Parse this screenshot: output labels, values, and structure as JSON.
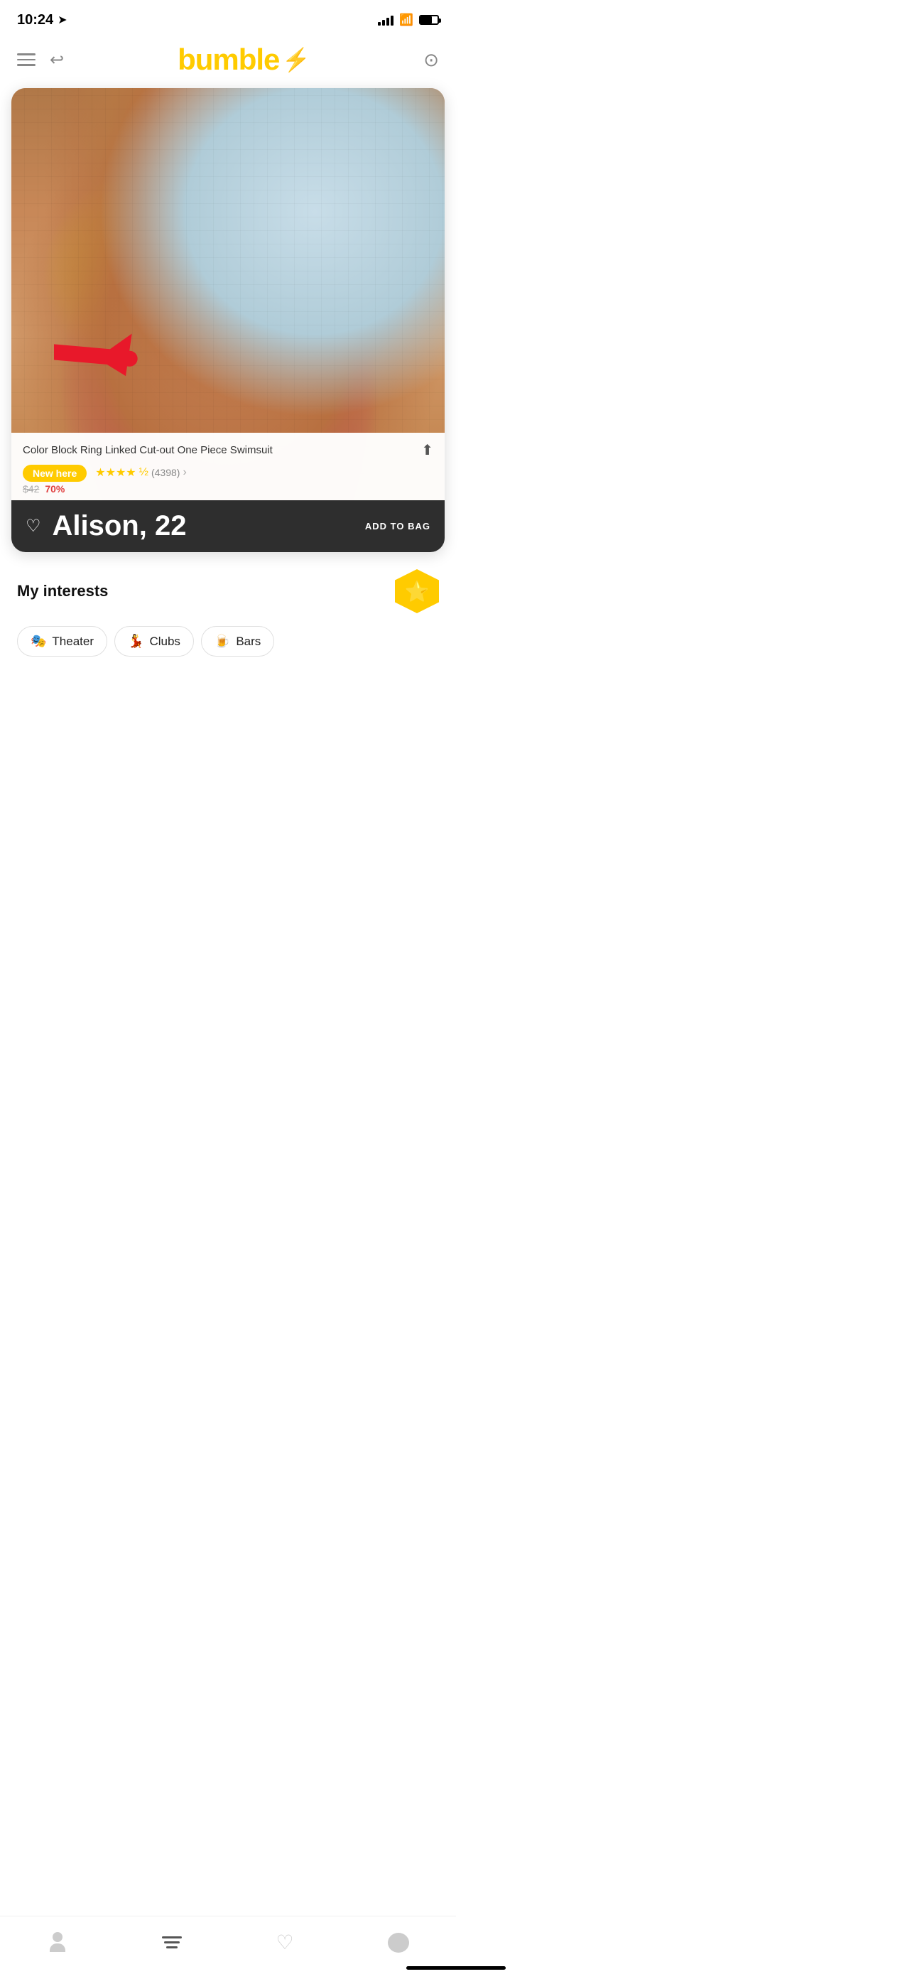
{
  "statusBar": {
    "time": "10:24",
    "locationIcon": "➤"
  },
  "header": {
    "menuIcon": "menu",
    "backIcon": "↩",
    "logo": "bumble",
    "logoLightning": "⚡",
    "filterIcon": "⊙"
  },
  "profileCard": {
    "productName": "Color Block Ring Linked Cut-out One Piece Swimsuit",
    "newHereBadge": "New here",
    "stars": "★★★★½",
    "reviewCount": "(4398)",
    "shareIcon": "↑",
    "priceOriginal": "$42",
    "priceDiscounted": "70%",
    "addToBagLabel": "ADD TO BAG",
    "personName": "Alison, 22",
    "heartIcon": "♡"
  },
  "interests": {
    "title": "My interests",
    "tags": [
      {
        "emoji": "🎭",
        "label": "Theater"
      },
      {
        "emoji": "💃",
        "label": "Clubs"
      },
      {
        "emoji": "🍺",
        "label": "Bars"
      }
    ],
    "boostIcon": "⭐"
  },
  "bottomNav": {
    "items": [
      {
        "id": "profile",
        "icon": "person"
      },
      {
        "id": "stack",
        "icon": "stack"
      },
      {
        "id": "heart",
        "icon": "♡"
      },
      {
        "id": "chat",
        "icon": "💬"
      }
    ]
  }
}
